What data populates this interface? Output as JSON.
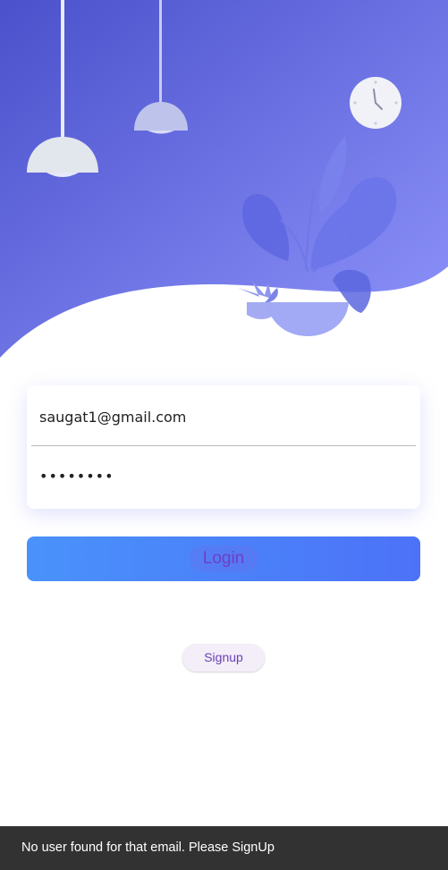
{
  "theme": {
    "hero_gradient_start": "#4c54cc",
    "hero_gradient_end": "#8f94fb",
    "button_gradient_start": "#4a92fb",
    "button_gradient_end": "#4c72f8",
    "accent_text": "#6d3fc7",
    "snackbar_bg": "#323232"
  },
  "hero": {
    "icons": [
      "hanging-lamp-icon",
      "hanging-lamp-icon",
      "wall-clock-icon",
      "potted-plant-icon"
    ]
  },
  "login_form": {
    "email_value": "saugat1@gmail.com",
    "password_value": "••••••••"
  },
  "buttons": {
    "login_label": "Login",
    "signup_label": "Signup"
  },
  "snackbar": {
    "message": "No user found for that email. Please SignUp"
  }
}
